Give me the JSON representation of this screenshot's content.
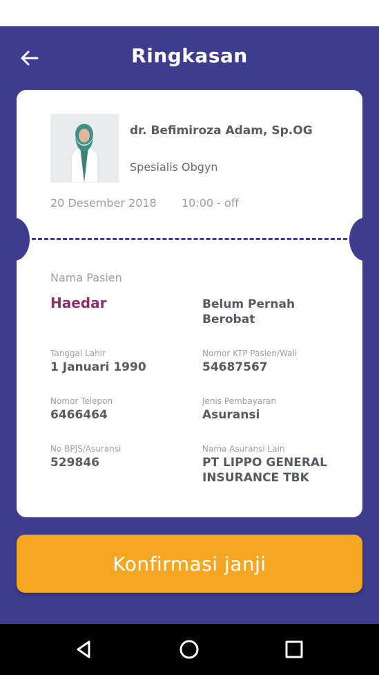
{
  "header": {
    "title": "Ringkasan",
    "back_icon": "arrow-left-icon"
  },
  "doctor": {
    "name": "dr. Befimiroza Adam, Sp.OG",
    "specialty": "Spesialis Obgyn",
    "date": "20 Desember 2018",
    "time": "10:00 - off"
  },
  "patient": {
    "label": "Nama Pasien",
    "name": "Haedar",
    "status": "Belum Pernah Berobat",
    "fields": [
      {
        "label": "Tanggal Lahir",
        "value": "1 Januari 1990"
      },
      {
        "label": "Nomor KTP Pasien/Wali",
        "value": "54687567"
      },
      {
        "label": "Nomor Telepon",
        "value": "6466464"
      },
      {
        "label": "Jenis Pembayaran",
        "value": "Asuransi"
      },
      {
        "label": "No BPJS/Asuransi",
        "value": "529846"
      },
      {
        "label": "Nama Asuransi Lain",
        "value": "PT LIPPO GENERAL INSURANCE TBK"
      }
    ]
  },
  "action": {
    "confirm_label": "Konfirmasi janji"
  },
  "nav": {
    "back_icon": "nav-back-icon",
    "home_icon": "nav-home-icon",
    "recents_icon": "nav-recents-icon"
  },
  "colors": {
    "primary": "#3d3c8f",
    "accent": "#f5a623",
    "patient_name": "#8a2f6a"
  }
}
